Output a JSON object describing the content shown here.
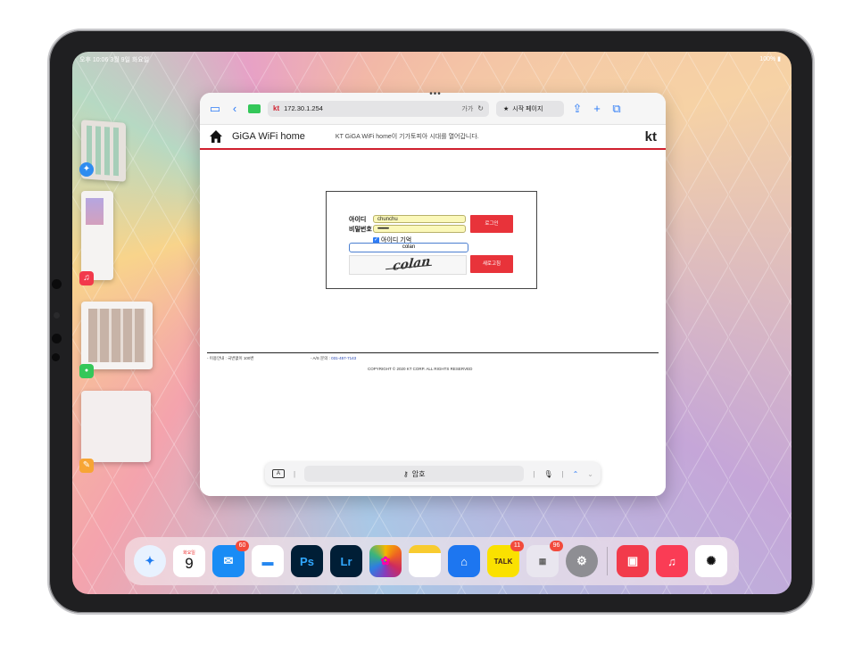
{
  "status_bar": {
    "time": "오후 10:06",
    "date": "3월 9일 화요일",
    "battery": "100%"
  },
  "browser": {
    "url": "172.30.1.254",
    "url_reader": "가가",
    "tab_label": "시작 페이지"
  },
  "kt_page": {
    "title": "GiGA WiFi home",
    "tagline": "KT GiGA WiFi home이 기가토피아 시대를 열어갑니다.",
    "logo": "kt",
    "login": {
      "id_label": "아이디",
      "id_value": "chunchu",
      "pw_label": "비밀번호",
      "pw_value": "•••••••••••",
      "remember_label": "아이디 기억",
      "remember_checked": true,
      "captcha_value": "colan",
      "captcha_text": "colan",
      "login_button": "로그인",
      "refresh_button": "새로고침"
    },
    "footer": {
      "usage": "- 이용안내 : 국번없이 100번",
      "as_label": "- A/S 문의 :",
      "as_number": "031-457-7143",
      "copyright": "COPYRIGHT © 2020 KT CORP. ALL RIGHTS RESERVED"
    }
  },
  "find_bar": {
    "key_label": "A",
    "password_label": "암호"
  },
  "dock": {
    "calendar_weekday": "화요일",
    "calendar_day": "9",
    "mail_badge": "60",
    "kakao_badge": "11",
    "folder_badge": "96",
    "ps_label": "Ps",
    "lr_label": "Lr",
    "talk_label": "TALK"
  },
  "colors": {
    "kt_red": "#d01f2e",
    "ios_blue": "#2e7cf6",
    "button_red": "#e8333a"
  }
}
